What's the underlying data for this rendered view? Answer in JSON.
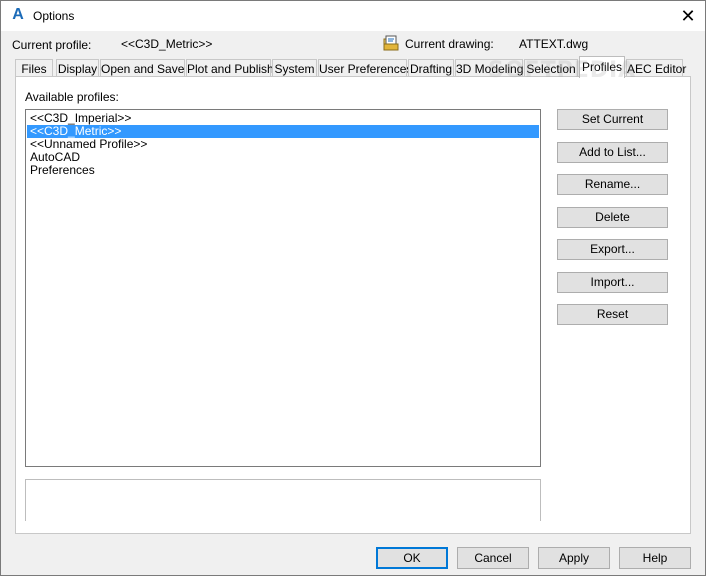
{
  "window": {
    "title": "Options",
    "close_glyph": "✕"
  },
  "profile_bar": {
    "current_profile_label": "Current profile:",
    "current_profile_value": "<<C3D_Metric>>",
    "current_drawing_label": "Current drawing:",
    "current_drawing_value": "ATTEXT.dwg"
  },
  "tabs": [
    {
      "label": "Files",
      "active": false
    },
    {
      "label": "Display",
      "active": false
    },
    {
      "label": "Open and Save",
      "active": false
    },
    {
      "label": "Plot and Publish",
      "active": false
    },
    {
      "label": "System",
      "active": false
    },
    {
      "label": "User Preferences",
      "active": false
    },
    {
      "label": "Drafting",
      "active": false
    },
    {
      "label": "3D Modeling",
      "active": false
    },
    {
      "label": "Selection",
      "active": false
    },
    {
      "label": "Profiles",
      "active": true
    },
    {
      "label": "AEC Editor",
      "active": false
    }
  ],
  "profiles_panel": {
    "available_label": "Available profiles:",
    "items": [
      {
        "label": "<<C3D_Imperial>>",
        "selected": false
      },
      {
        "label": "<<C3D_Metric>>",
        "selected": true
      },
      {
        "label": "<<Unnamed Profile>>",
        "selected": false
      },
      {
        "label": "AutoCAD",
        "selected": false
      },
      {
        "label": "Preferences",
        "selected": false
      }
    ],
    "buttons": {
      "set_current": "Set Current",
      "add_to_list": "Add to List...",
      "rename": "Rename...",
      "delete": "Delete",
      "export": "Export...",
      "import": "Import...",
      "reset": "Reset"
    }
  },
  "footer": {
    "ok": "OK",
    "cancel": "Cancel",
    "apply": "Apply",
    "help": "Help"
  },
  "watermark": "SOFTPEDIA",
  "colors": {
    "selection": "#3399ff",
    "app_icon": "#1c6bb8",
    "default_button_border": "#0078d7"
  },
  "icons": {
    "app": "autocad-a-icon",
    "drawing": "drawing-file-icon",
    "close": "close-icon"
  }
}
